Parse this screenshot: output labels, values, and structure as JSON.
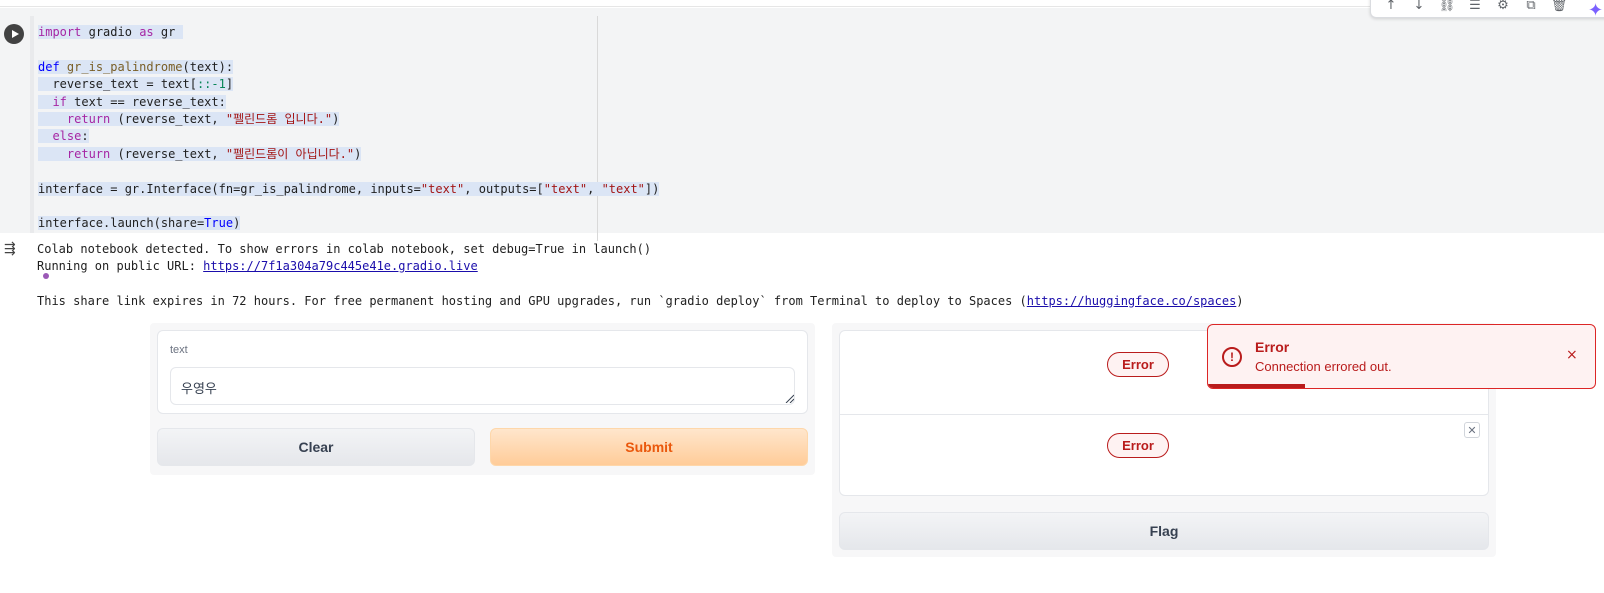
{
  "toolbar": {
    "icons": [
      "arrow-up-icon",
      "arrow-down-icon",
      "link-icon",
      "comment-icon",
      "gear-icon",
      "mirror-cell-icon",
      "delete-icon"
    ]
  },
  "code": {
    "line1": [
      "import",
      "gradio",
      "as",
      "gr"
    ],
    "line3": [
      "def",
      "gr_is_palindrome",
      "(text):"
    ],
    "line4": [
      "reverse_text = text[",
      "::-1",
      "]"
    ],
    "line5": [
      "if",
      "text == reverse_text:"
    ],
    "line6": [
      "return",
      "(reverse_text, ",
      "\"펠린드롬 입니다.\"",
      ")"
    ],
    "line7": [
      "else",
      ":"
    ],
    "line8": [
      "return",
      "(reverse_text, ",
      "\"펠린드롬이 아닙니다.\"",
      ")"
    ],
    "line10": [
      "interface = gr.Interface(fn=gr_is_palindrome, inputs=",
      "\"text\"",
      ", outputs=[",
      "\"text\"",
      ", ",
      "\"text\"",
      "])"
    ],
    "line12": [
      "interface.launch(share=",
      "True",
      ")"
    ]
  },
  "output": {
    "line1": "Colab notebook detected. To show errors in colab notebook, set debug=True in launch()",
    "line2_prefix": "Running on public URL: ",
    "line2_link": "https://7f1a304a79c445e41e.gradio.live",
    "line4_prefix": "This share link expires in 72 hours. For free permanent hosting and GPU upgrades, run `gradio deploy` from Terminal to deploy to Spaces (",
    "line4_link": "https://huggingface.co/spaces",
    "line4_suffix": ")"
  },
  "app": {
    "input_label": "text",
    "input_value": "우영우",
    "clear_label": "Clear",
    "submit_label": "Submit",
    "output1_status": "Error",
    "output2_status": "Error",
    "flag_label": "Flag"
  },
  "toast": {
    "title": "Error",
    "message": "Connection errored out.",
    "close": "×",
    "progress": 0.25
  },
  "colors": {
    "error": "#b91c1c",
    "submit_text": "#ea580c",
    "link": "#1a0dab"
  }
}
